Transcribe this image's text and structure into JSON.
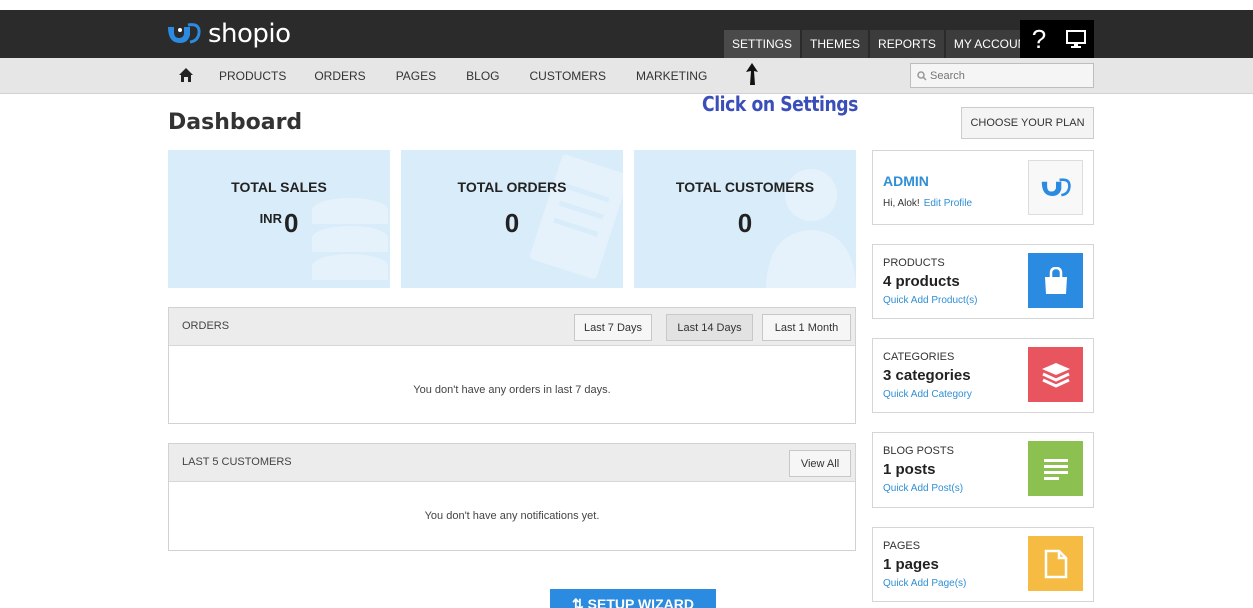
{
  "brand": {
    "name": "shopio"
  },
  "topnav": {
    "settings": "SETTINGS",
    "themes": "THEMES",
    "reports": "REPORTS",
    "my_account": "MY ACCOUNT",
    "help": "?"
  },
  "subnav": {
    "items": [
      "PRODUCTS",
      "ORDERS",
      "PAGES",
      "BLOG",
      "CUSTOMERS",
      "MARKETING"
    ],
    "search_placeholder": "Search"
  },
  "annotation": {
    "text": "Click on Settings"
  },
  "page": {
    "title": "Dashboard",
    "choose_plan": "CHOOSE YOUR PLAN"
  },
  "stats": {
    "sales": {
      "label": "TOTAL SALES",
      "currency": "INR",
      "value": "0"
    },
    "orders": {
      "label": "TOTAL ORDERS",
      "value": "0"
    },
    "customers": {
      "label": "TOTAL CUSTOMERS",
      "value": "0"
    }
  },
  "orders_panel": {
    "title": "ORDERS",
    "filters": [
      "Last 7 Days",
      "Last 14 Days",
      "Last 1 Month"
    ],
    "empty": "You don't have any orders in last 7 days."
  },
  "customers_panel": {
    "title": "LAST 5 CUSTOMERS",
    "view_all": "View All",
    "empty": "You don't have any notifications yet."
  },
  "admin": {
    "name": "ADMIN",
    "greeting": "Hi, Alok!",
    "edit": "Edit Profile"
  },
  "cards": {
    "products": {
      "title": "PRODUCTS",
      "count": "4 products",
      "link": "Quick Add Product(s)",
      "color": "#2a8be0"
    },
    "categories": {
      "title": "CATEGORIES",
      "count": "3 categories",
      "link": "Quick Add Category",
      "color": "#e8555e"
    },
    "blog": {
      "title": "BLOG POSTS",
      "count": "1 posts",
      "link": "Quick Add Post(s)",
      "color": "#8cc152"
    },
    "pages": {
      "title": "PAGES",
      "count": "1 pages",
      "link": "Quick Add Page(s)",
      "color": "#f6bb42"
    }
  },
  "wizard": {
    "label": "SETUP WIZARD",
    "icon": "wizard-arrows-icon"
  },
  "colors": {
    "topbar": "#2b2b2b",
    "accent": "#2a8be0",
    "tile": "#d9ecf9",
    "annotation": "#3a4fb8"
  }
}
